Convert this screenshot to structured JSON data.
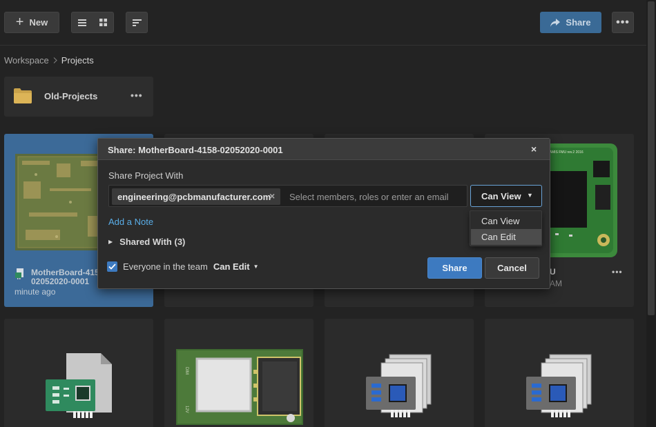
{
  "toolbar": {
    "new_label": "New",
    "share_label": "Share",
    "icons": [
      "plus-icon",
      "list-view-icon",
      "grid-view-icon",
      "sort-icon",
      "share-arrow-icon",
      "more-icon"
    ]
  },
  "breadcrumb": {
    "root": "Workspace",
    "separator": ">",
    "current": "Projects"
  },
  "folder": {
    "name": "Old-Projects",
    "more": "•••"
  },
  "cards": [
    {
      "title_line1": "MotherBoard-415",
      "title_line2": "02052020-0001",
      "subtitle": "minute ago",
      "selected": true
    },
    {
      "title_line1": "U",
      "subtitle": "AM",
      "more": "•••"
    }
  ],
  "dialog": {
    "title": "Share: MotherBoard-4158-02052020-0001",
    "close": "×",
    "share_with_label": "Share Project With",
    "chip_email": "engineering@pcbmanufacturer.com",
    "chip_remove": "×",
    "placeholder": "Select members, roles or enter an email",
    "permission_value": "Can View",
    "add_note": "Add a Note",
    "shared_with": "Shared With (3)",
    "team_label": "Everyone in the team",
    "team_permission": "Can Edit",
    "share_button": "Share",
    "cancel_button": "Cancel"
  },
  "permission_dropdown": {
    "options": [
      "Can View",
      "Can Edit"
    ],
    "hovered": "Can Edit"
  },
  "colors": {
    "accent": "#3d7ac0",
    "link": "#5aaee8",
    "selected_card": "#3c6a98",
    "background": "#232323"
  }
}
